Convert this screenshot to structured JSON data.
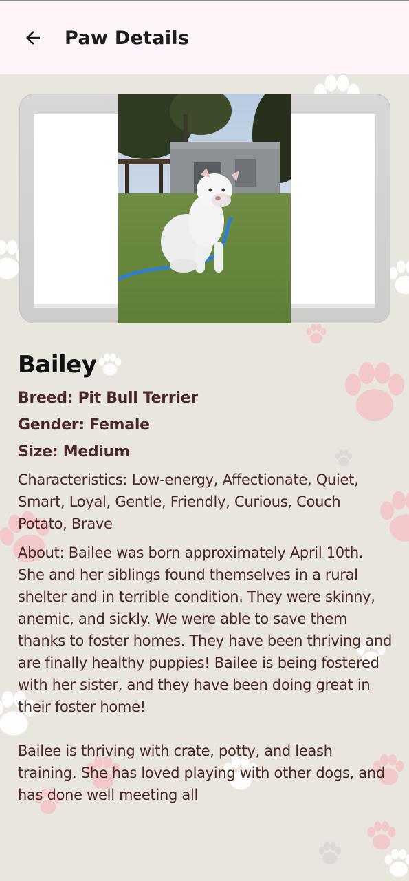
{
  "app_bar": {
    "title": "Paw Details",
    "back_icon": "arrow-left-icon"
  },
  "pet": {
    "name": "Bailey",
    "breed": "Breed: Pit Bull Terrier",
    "gender": "Gender: Female",
    "size": "Size: Medium",
    "characteristics": "Characteristics: Low-energy, Affectionate, Quiet, Smart, Loyal, Gentle, Friendly, Curious, Couch Potato, Brave",
    "about": "About: Bailee was born approximately April 10th. She and her siblings found themselves in a rural shelter and in terrible condition. They were skinny, anemic, and sickly. We were able to save them thanks to foster homes. They have been thriving and are finally healthy puppies! Bailee is being fostered with her sister, and they have been doing great in their foster home!",
    "about_more": "Bailee is thriving with crate, potty, and leash training. She has loved playing with other dogs, and has done well meeting all"
  },
  "colors": {
    "app_bar_bg": "#fcf4f8",
    "page_bg": "#e9e5df",
    "text_brown": "#4a2727",
    "paw_pink": "#f2b6bd"
  }
}
